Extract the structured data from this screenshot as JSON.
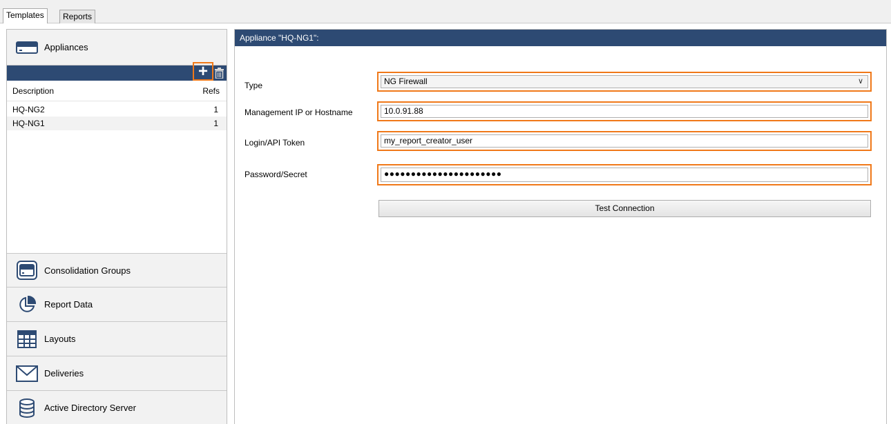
{
  "tabs": [
    {
      "label": "Templates"
    },
    {
      "label": "Reports"
    }
  ],
  "sidebar": {
    "appliances_label": "Appliances",
    "list": {
      "columns": [
        "Description",
        "Refs"
      ],
      "rows": [
        {
          "description": "HQ-NG2",
          "refs": "1"
        },
        {
          "description": "HQ-NG1",
          "refs": "1"
        }
      ]
    },
    "sections": [
      {
        "label": "Consolidation Groups",
        "icon": "appliance-group-icon"
      },
      {
        "label": "Report Data",
        "icon": "pie-chart-icon"
      },
      {
        "label": "Layouts",
        "icon": "grid-layout-icon"
      },
      {
        "label": "Deliveries",
        "icon": "envelope-icon"
      },
      {
        "label": "Active Directory Server",
        "icon": "database-icon"
      }
    ]
  },
  "form": {
    "title": "Appliance \"HQ-NG1\":",
    "type_label": "Type",
    "type_value": "NG Firewall",
    "mgmt_label": "Management IP or Hostname",
    "mgmt_value": "10.0.91.88",
    "login_label": "Login/API Token",
    "login_value": "my_report_creator_user",
    "password_label": "Password/Secret",
    "password_value": "●●●●●●●●●●●●●●●●●●●●●●",
    "test_button": "Test Connection"
  },
  "colors": {
    "header_bar": "#2d4a73",
    "highlight": "#f07818",
    "icon_blue": "#2d4a73"
  }
}
